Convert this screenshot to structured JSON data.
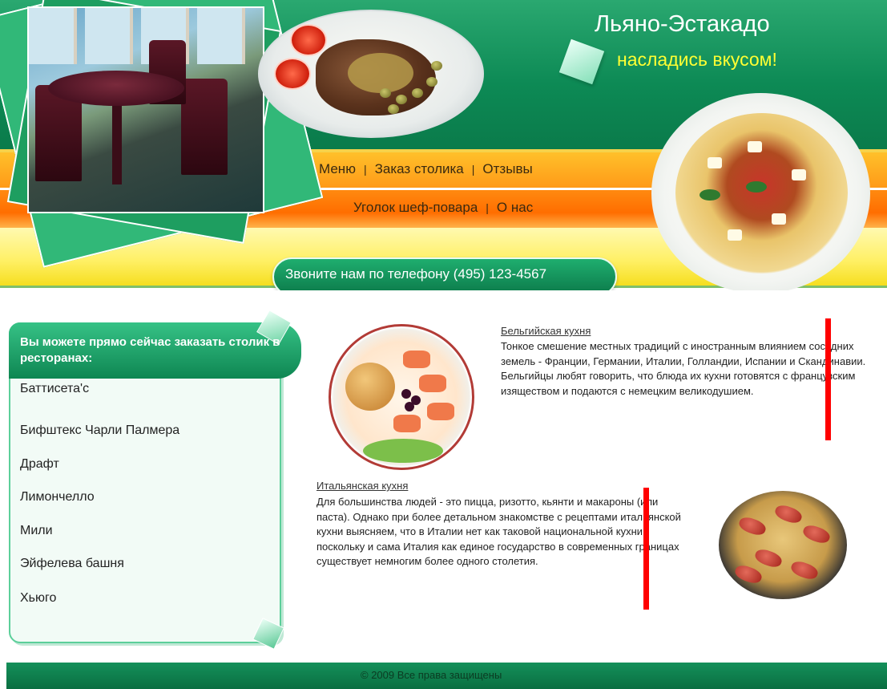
{
  "brand": {
    "title": "Льяно-Эстакадо",
    "slogan": "насладись вкусом!"
  },
  "nav": {
    "row1": [
      "Меню",
      "Заказ столика",
      "Отзывы"
    ],
    "row2": [
      "Уголок шеф-повара",
      "О нас"
    ],
    "separator": "|"
  },
  "phone": {
    "text": "Звоните нам по телефону (495) 123-4567"
  },
  "sidebar": {
    "heading": "Вы можете прямо сейчас заказать столик в ресторанах:",
    "items": [
      "Баттисета'с",
      "Бифштекс Чарли Палмера",
      "Драфт",
      "Лимончелло",
      "Мили",
      "Эйфелева башня",
      "Хьюго"
    ]
  },
  "articles": [
    {
      "title": "Бельгийская кухня",
      "text": "Тонкое смешение местных традиций с иностранным влиянием соседних земель - Франции, Германии, Италии, Голландии, Испании и Скандинавии. Бельгийцы любят говорить, что блюда их кухни готовятся с французским изяществом и подаются с немецким великодушием."
    },
    {
      "title": "Итальянская кухня",
      "text": "Для большинства людей - это пицца, ризотто, кьянти и макароны (или паста). Однако при более детальном знакомстве с рецептами итальянской кухни выясняем, что в Италии нет как таковой национальной кухни, поскольку и сама Италия как единое государство в современных границах существует немногим более одного столетия."
    }
  ],
  "footer": {
    "copyright": "© 2009 Все права защищены"
  },
  "colors": {
    "header_green": "#0d8a55",
    "nav_orange": "#ff9a18",
    "slogan_yellow": "#ffff33",
    "annotation_red": "#ff0000"
  }
}
